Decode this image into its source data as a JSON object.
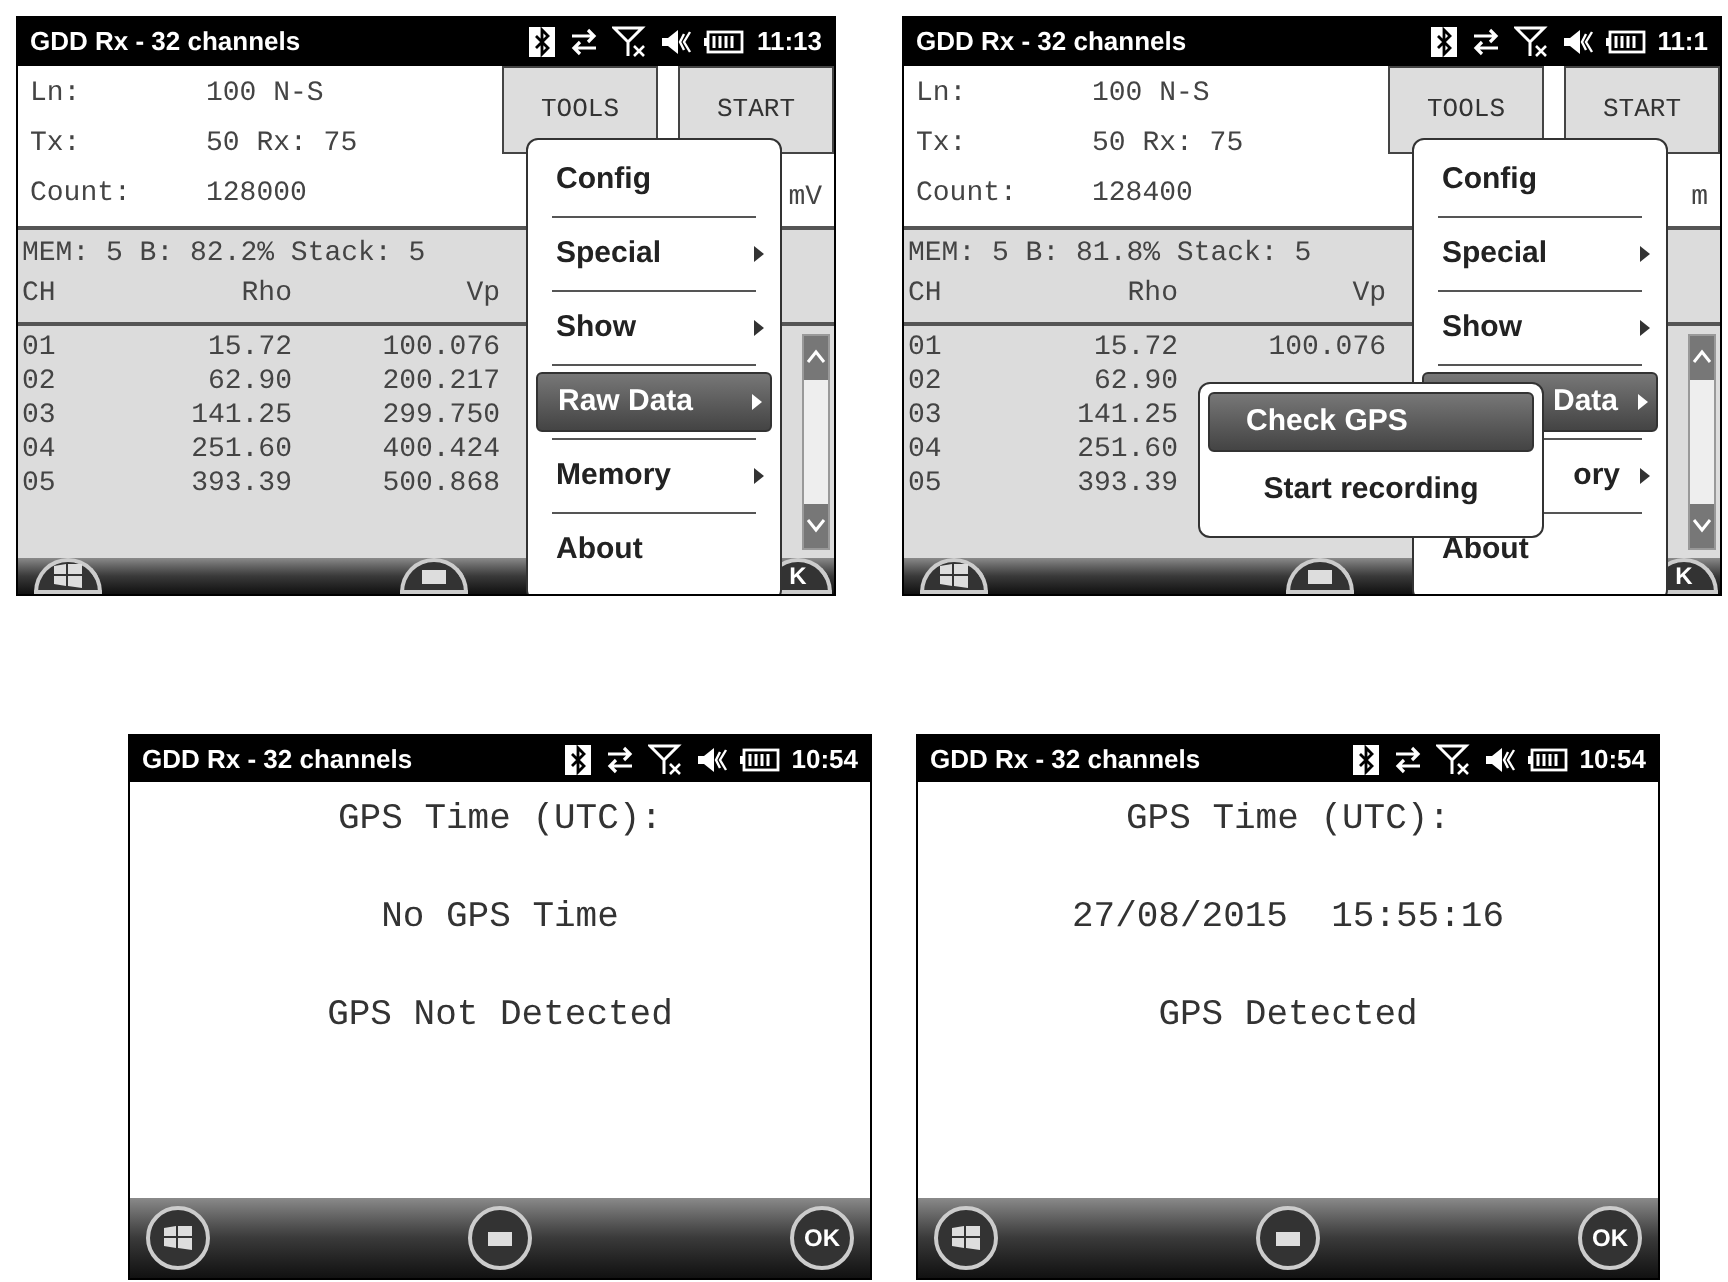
{
  "screens": [
    {
      "kind": "main",
      "title": "GDD Rx - 32 channels",
      "clock": "11:13",
      "info": [
        {
          "label": "Ln:",
          "value": "100 N-S"
        },
        {
          "label": "Tx:",
          "value": "50 Rx: 75"
        },
        {
          "label": "Count:",
          "value": "128000"
        }
      ],
      "buttons": [
        "TOOLS",
        "START"
      ],
      "unit": "mV",
      "mem_line": "MEM: 5 B: 82.2% Stack: 5",
      "columns": [
        "CH",
        "Rho",
        "Vp"
      ],
      "rows": [
        [
          "01",
          "15.72",
          "100.076"
        ],
        [
          "02",
          "62.90",
          "200.217"
        ],
        [
          "03",
          "141.25",
          "299.750"
        ],
        [
          "04",
          "251.60",
          "400.424"
        ],
        [
          "05",
          "393.39",
          "500.868"
        ]
      ],
      "menu": [
        {
          "label": "Config",
          "submenu": false,
          "partial": false,
          "selected": false
        },
        {
          "label": "Special",
          "submenu": true,
          "partial": false,
          "selected": false
        },
        {
          "label": "Show",
          "submenu": true,
          "partial": false,
          "selected": false
        },
        {
          "label": "Raw Data",
          "submenu": true,
          "partial": false,
          "selected": true
        },
        {
          "label": "Memory",
          "submenu": true,
          "partial": false,
          "selected": false
        },
        {
          "label": "About",
          "submenu": false,
          "partial": false,
          "selected": false
        }
      ],
      "ok": "K"
    },
    {
      "kind": "main",
      "title": "GDD Rx - 32 channels",
      "clock": "11:1",
      "info": [
        {
          "label": "Ln:",
          "value": "100 N-S"
        },
        {
          "label": "Tx:",
          "value": "50 Rx: 75"
        },
        {
          "label": "Count:",
          "value": "128400"
        }
      ],
      "buttons": [
        "TOOLS",
        "START"
      ],
      "unit": "m",
      "mem_line": "MEM: 5 B: 81.8% Stack: 5",
      "columns": [
        "CH",
        "Rho",
        "Vp"
      ],
      "rows": [
        [
          "01",
          "15.72",
          "100.076"
        ],
        [
          "02",
          "62.90"
        ],
        [
          "03",
          "141.25"
        ],
        [
          "04",
          "251.60"
        ],
        [
          "05",
          "393.39"
        ]
      ],
      "menu": [
        {
          "label": "Config",
          "submenu": false,
          "partial": false,
          "selected": false
        },
        {
          "label": "Special",
          "submenu": true,
          "partial": false,
          "selected": false
        },
        {
          "label": "Show",
          "submenu": true,
          "partial": false,
          "selected": false
        },
        {
          "label": "Data",
          "submenu": true,
          "partial": true,
          "selected": true
        },
        {
          "label": "ory",
          "submenu": true,
          "partial": true,
          "selected": false
        },
        {
          "label": "About",
          "submenu": false,
          "partial": false,
          "selected": false
        }
      ],
      "submenu": [
        {
          "label": "Check GPS",
          "selected": true
        },
        {
          "label": "Start recording",
          "selected": false
        }
      ],
      "ok": "K"
    },
    {
      "kind": "gps",
      "title": "GDD Rx - 32 channels",
      "clock": "10:54",
      "lines": [
        "GPS Time (UTC):",
        "No GPS Time",
        "GPS Not Detected"
      ],
      "ok": "OK"
    },
    {
      "kind": "gps",
      "title": "GDD Rx - 32 channels",
      "clock": "10:54",
      "lines": [
        "GPS Time (UTC):",
        "27/08/2015  15:55:16",
        "GPS Detected"
      ],
      "ok": "OK"
    }
  ]
}
